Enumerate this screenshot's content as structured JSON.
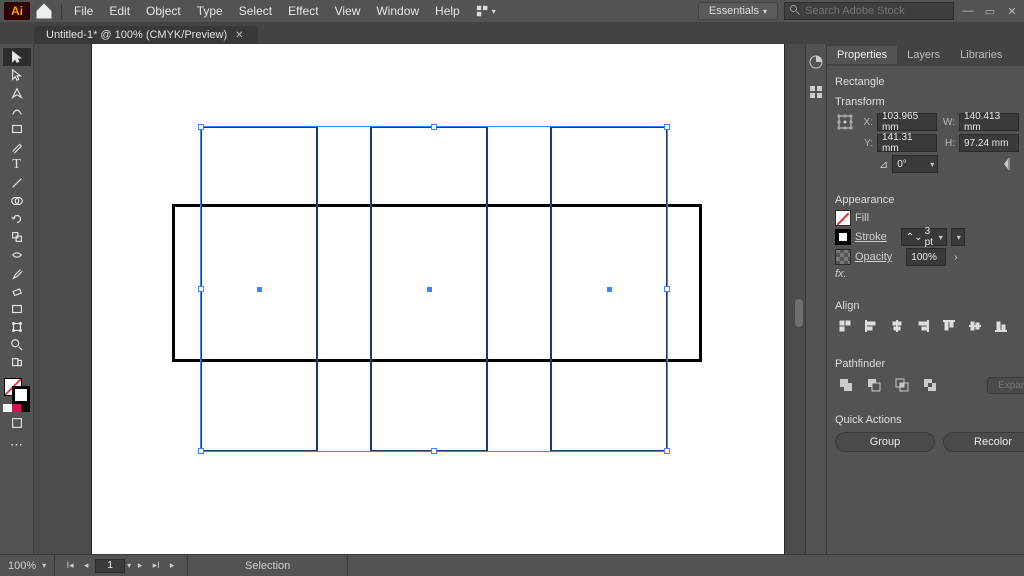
{
  "app": {
    "logo_text": "Ai"
  },
  "menu": {
    "items": [
      "File",
      "Edit",
      "Object",
      "Type",
      "Select",
      "Effect",
      "View",
      "Window",
      "Help"
    ]
  },
  "workspace": {
    "label": "Essentials"
  },
  "search": {
    "placeholder": "Search Adobe Stock"
  },
  "tab": {
    "title": "Untitled-1* @ 100% (CMYK/Preview)"
  },
  "statusbar": {
    "zoom": "100%",
    "artboard_index": "1",
    "tool": "Selection"
  },
  "properties": {
    "tabs": [
      "Properties",
      "Layers",
      "Libraries"
    ],
    "object_type": "Rectangle",
    "sections": {
      "transform": "Transform",
      "appearance": "Appearance",
      "align": "Align",
      "pathfinder": "Pathfinder",
      "quick": "Quick Actions"
    },
    "transform": {
      "x_label": "X:",
      "x": "103.965 mm",
      "y_label": "Y:",
      "y": "141.31 mm",
      "w_label": "W:",
      "w": "140.413 mm",
      "h_label": "H:",
      "h": "97.24 mm",
      "rotate": "0°"
    },
    "appearance": {
      "fill_label": "Fill",
      "stroke_label": "Stroke",
      "stroke_weight": "3 pt",
      "opacity_label": "Opacity",
      "opacity_value": "100%"
    },
    "pathfinder": {
      "expand": "Expand"
    },
    "quick_actions": {
      "group": "Group",
      "recolor": "Recolor"
    }
  }
}
